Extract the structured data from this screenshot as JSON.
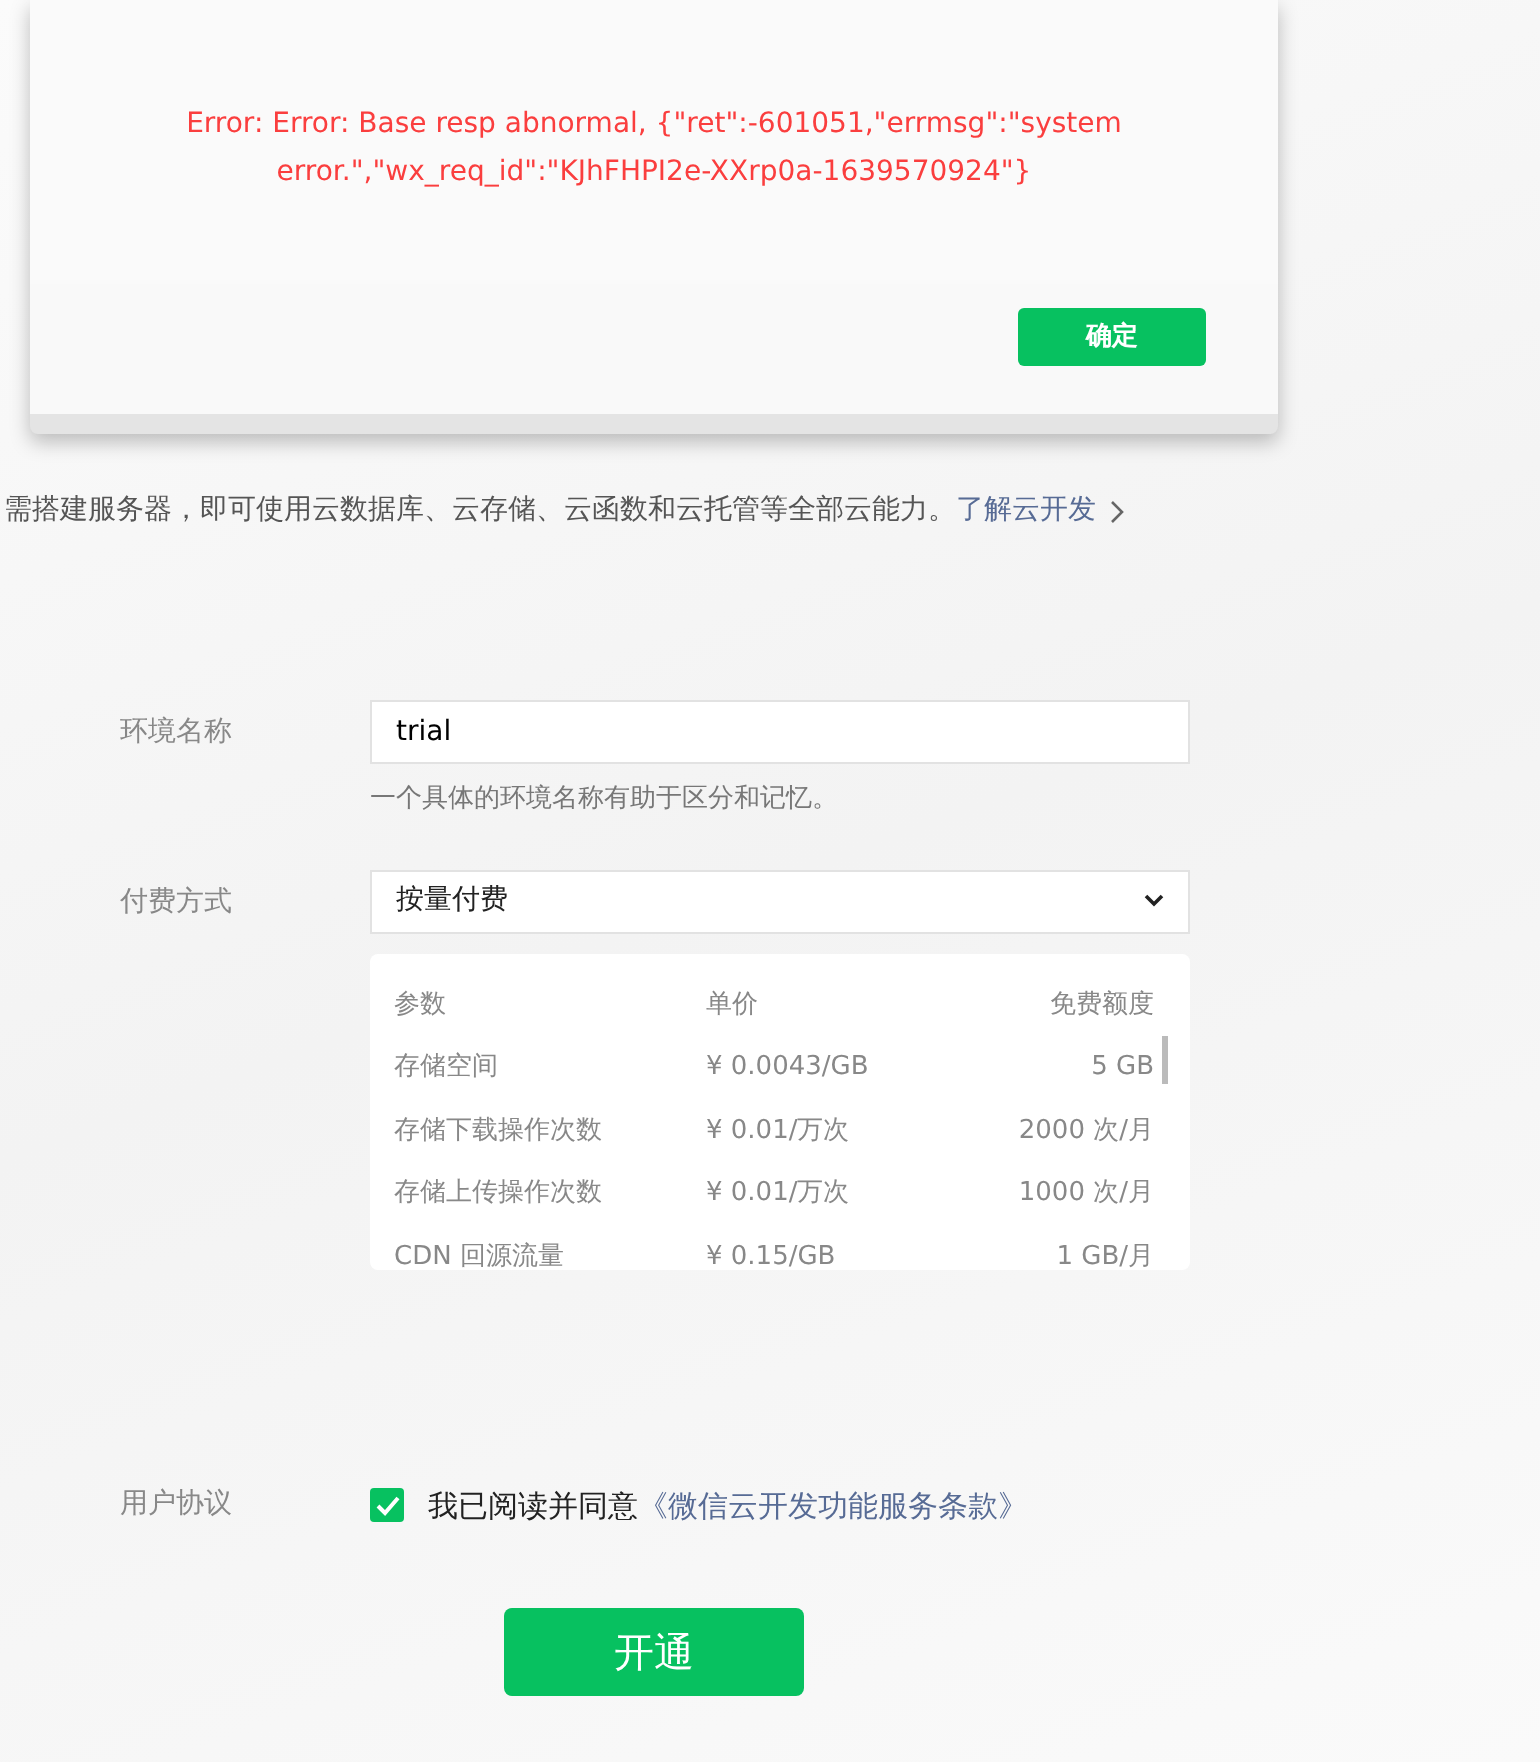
{
  "dialog": {
    "message": "Error: Error: Base resp abnormal, {\"ret\":-601051,\"errmsg\":\"system error.\",\"wx_req_id\":\"KJhFHPI2e-XXrp0a-1639570924\"}",
    "confirm_button": "确定"
  },
  "intro": {
    "text": "需搭建服务器，即可使用云数据库、云存储、云函数和云托管等全部云能力。",
    "link": "了解云开发"
  },
  "env_name": {
    "label": "环境名称",
    "value": "trial",
    "hint": "一个具体的环境名称有助于区分和记忆。"
  },
  "billing": {
    "label": "付费方式",
    "value": "按量付费",
    "table": {
      "columns": [
        "参数",
        "单价",
        "免费额度"
      ],
      "rows": [
        [
          "存储空间",
          "¥ 0.0043/GB",
          "5 GB"
        ],
        [
          "存储下载操作次数",
          "¥ 0.01/万次",
          "2000 次/月"
        ],
        [
          "存储上传操作次数",
          "¥ 0.01/万次",
          "1000 次/月"
        ],
        [
          "CDN 回源流量",
          "¥ 0.15/GB",
          "1 GB/月"
        ]
      ]
    }
  },
  "agreement": {
    "label": "用户协议",
    "checked": true,
    "text": "我已阅读并同意",
    "link": "《微信云开发功能服务条款》"
  },
  "submit_button": "开通"
}
